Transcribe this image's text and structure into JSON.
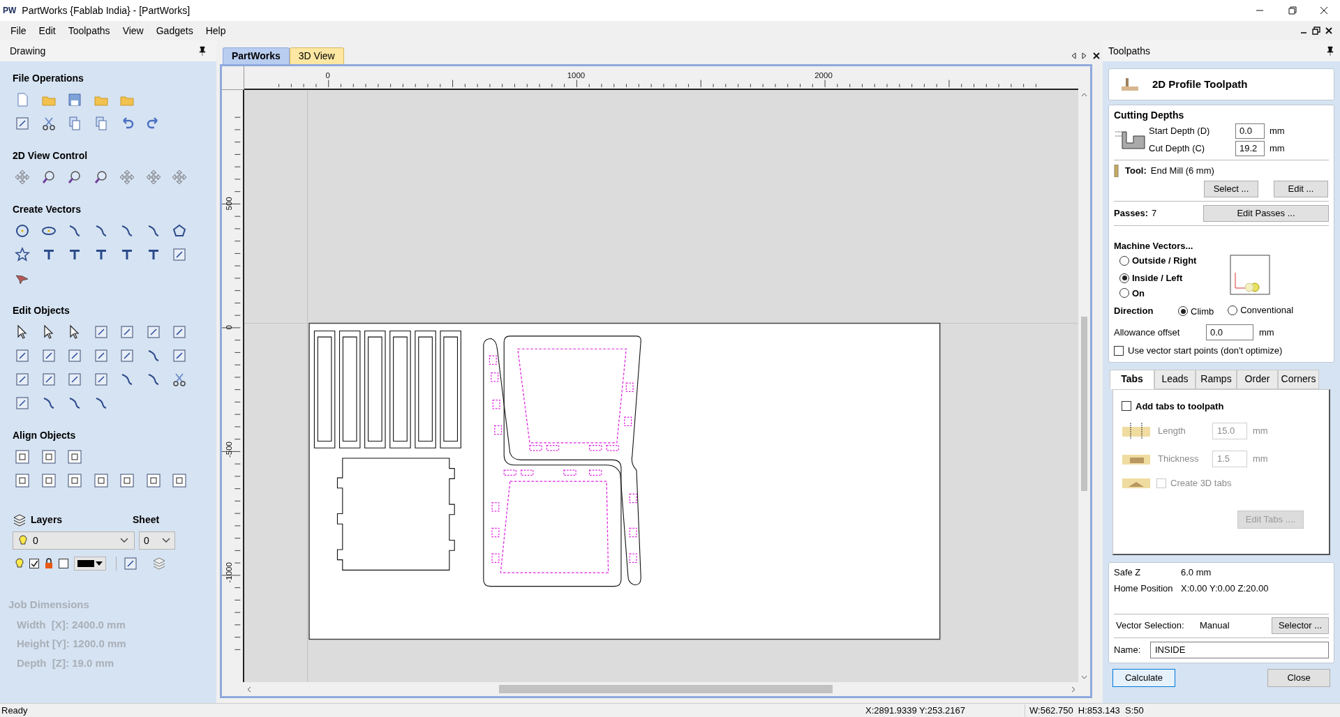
{
  "window": {
    "logo": "PW",
    "title": "PartWorks {Fablab India} - [PartWorks]"
  },
  "menu": [
    "File",
    "Edit",
    "Toolpaths",
    "View",
    "Gadgets",
    "Help"
  ],
  "drawing_panel": {
    "title": "Drawing",
    "sections": [
      {
        "title": "File Operations"
      },
      {
        "title": "2D View Control"
      },
      {
        "title": "Create Vectors"
      },
      {
        "title": "Edit Objects"
      },
      {
        "title": "Align Objects"
      }
    ],
    "layers": {
      "label": "Layers",
      "layer_value": "0",
      "sheet_label": "Sheet",
      "sheet_value": "0",
      "visible_checked": true,
      "lock_checked": false
    },
    "job_dimensions": {
      "title": "Job Dimensions",
      "lines": [
        "Width  [X]: 2400.0 mm",
        "Height [Y]: 1200.0 mm",
        "Depth  [Z]: 19.0 mm"
      ]
    }
  },
  "doc_tabs": [
    {
      "label": "PartWorks",
      "selected": true
    },
    {
      "label": "3D View",
      "selected": false
    }
  ],
  "ruler": {
    "x_labels": [
      "0",
      "1000",
      "2000"
    ],
    "y_labels": [
      "500",
      "0",
      "-500",
      "-1000"
    ]
  },
  "toolpaths_panel": {
    "title": "Toolpaths",
    "header": "2D Profile Toolpath",
    "cutting_depths": {
      "title": "Cutting Depths",
      "fields": [
        {
          "label": "Start Depth (D)",
          "value": "0.0",
          "unit": "mm"
        },
        {
          "label": "Cut Depth (C)",
          "value": "19.2",
          "unit": "mm"
        }
      ]
    },
    "tool": {
      "label": "Tool:",
      "value": "End Mill (6 mm)",
      "buttons": [
        "Select ...",
        "Edit ..."
      ]
    },
    "passes": {
      "label": "Passes:",
      "value": "7",
      "button": "Edit Passes ..."
    },
    "machine_vectors": {
      "title": "Machine Vectors...",
      "options": [
        {
          "label": "Outside / Right",
          "selected": false
        },
        {
          "label": "Inside / Left",
          "selected": true
        },
        {
          "label": "On",
          "selected": false
        }
      ]
    },
    "direction": {
      "label": "Direction",
      "options": [
        {
          "label": "Climb",
          "selected": true
        },
        {
          "label": "Conventional",
          "selected": false
        }
      ]
    },
    "allowance": {
      "label": "Allowance offset",
      "value": "0.0",
      "unit": "mm"
    },
    "start_points": {
      "label": "Use vector start points (don't optimize)",
      "checked": false
    },
    "tabs": [
      {
        "label": "Tabs",
        "selected": true
      },
      {
        "label": "Leads",
        "selected": false
      },
      {
        "label": "Ramps",
        "selected": false
      },
      {
        "label": "Order",
        "selected": false
      },
      {
        "label": "Corners",
        "selected": false
      }
    ],
    "tab_content": {
      "add_tabs": {
        "label": "Add tabs to toolpath",
        "checked": false
      },
      "fields": [
        {
          "label": "Length",
          "value": "15.0",
          "unit": "mm",
          "disabled": true
        },
        {
          "label": "Thickness",
          "value": "1.5",
          "unit": "mm",
          "disabled": true
        }
      ],
      "create_3d": {
        "label": "Create 3D tabs",
        "checked": false,
        "disabled": true
      },
      "edit_button": {
        "label": "Edit Tabs ....",
        "disabled": true
      }
    },
    "info": {
      "safe_z_label": "Safe Z",
      "safe_z": "6.0 mm",
      "home_label": "Home Position",
      "home": "X:0.00 Y:0.00 Z:20.00",
      "vector_label": "Vector Selection:",
      "vector_value": "Manual",
      "selector_button": "Selector ...",
      "name_label": "Name:",
      "name_value": "INSIDE"
    },
    "buttons": [
      "Calculate",
      "Close"
    ]
  },
  "status_bar": {
    "message": "Ready",
    "cursor": "X:2891.9339 Y:253.2167",
    "size": "W:562.750  H:853.143  S:50"
  }
}
